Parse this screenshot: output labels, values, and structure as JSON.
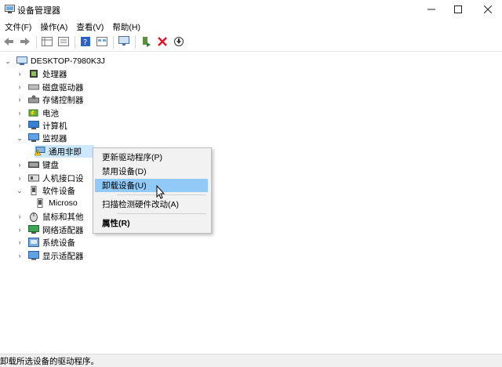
{
  "window": {
    "title": "设备管理器"
  },
  "menu": [
    "文件(F)",
    "操作(A)",
    "查看(V)",
    "帮助(H)"
  ],
  "toolbar": [
    "back-icon",
    "forward-icon",
    "properties-grid-icon",
    "properties-icon",
    "help-icon",
    "view-icon",
    "monitor-scan-icon",
    "update-driver-icon",
    "uninstall-x-icon",
    "download-icon"
  ],
  "tree": {
    "root": "DESKTOP-7980K3J",
    "items": [
      {
        "label": "处理器",
        "icon": "cpu-icon"
      },
      {
        "label": "磁盘驱动器",
        "icon": "disk-icon"
      },
      {
        "label": "存储控制器",
        "icon": "storage-icon"
      },
      {
        "label": "电池",
        "icon": "battery-icon"
      },
      {
        "label": "计算机",
        "icon": "computer-icon"
      },
      {
        "label": "监视器",
        "icon": "monitor-icon",
        "expanded": true
      },
      {
        "label": "通用非即",
        "icon": "warning-monitor-icon",
        "child": true,
        "selected": true
      },
      {
        "label": "键盘",
        "icon": "keyboard-icon"
      },
      {
        "label": "人机接口设",
        "icon": "hid-icon"
      },
      {
        "label": "软件设备",
        "icon": "software-icon",
        "expanded": true
      },
      {
        "label": "Microso",
        "icon": "software-device-icon",
        "child": true
      },
      {
        "label": "鼠标和其他",
        "icon": "mouse-icon"
      },
      {
        "label": "网络适配器",
        "icon": "network-icon"
      },
      {
        "label": "系统设备",
        "icon": "system-icon"
      },
      {
        "label": "显示适配器",
        "icon": "display-adapter-icon"
      }
    ]
  },
  "context_menu": {
    "items": [
      "更新驱动程序(P)",
      "禁用设备(D)",
      "卸载设备(U)",
      "扫描检测硬件改动(A)",
      "属性(R)"
    ],
    "highlighted": "卸载设备(U)"
  },
  "status_bar": {
    "text": "卸载所选设备的驱动程序。"
  },
  "colors": {
    "selection": "#cce8ff",
    "menu_highlight": "#91c9f7",
    "red_x": "#e81123"
  }
}
